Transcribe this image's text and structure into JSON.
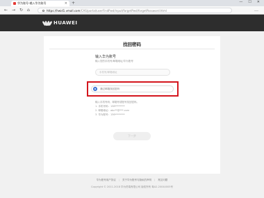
{
  "browser": {
    "tab_title": "华为账号-输入华为账号",
    "tab_close": "×",
    "new_tab": "+",
    "window_controls": [
      "—",
      "☐",
      "✕"
    ],
    "nav": {
      "back": "←",
      "forward": "→",
      "reload": "↻",
      "home": "⌂",
      "more": "…"
    },
    "url_domain": "https://hwid1.vmall.com",
    "url_path": "/CAS/portal/userFindPwd/input/forgetPwd/forgetPassword.html"
  },
  "header": {
    "logo_text": "HUAWEI"
  },
  "card": {
    "title": "找回密码",
    "section_heading": "输入华为账号",
    "section_sub": "输入您的手机号/邮箱地址/华为账号",
    "account_input": {
      "value": "",
      "placeholder": "手机号/邮箱地址"
    },
    "method_option_label": "通过邮箱找回密码",
    "options_intro": "输入手机号码、邮箱号或账号找回密码。",
    "options": [
      "1. 手机号码：138********",
      "2. 邮箱地址：abc**@***.com",
      "3. 华为账号：136********"
    ],
    "next_label": "下一步"
  },
  "footer": {
    "links": [
      "华为账号用户协议",
      "关于华为账号与隐私的声明",
      "常见问题"
    ],
    "copyright": "Copyright © 2011-2018 华为终端有限公司 版权所有 粤A2-20044005号"
  },
  "colors": {
    "header_bg": "#2d2d2d",
    "highlight_border": "#d4151d",
    "radio_accent": "#3a73d4",
    "page_bg": "#f1f1f1"
  },
  "icons": {
    "favicon": "huawei-favicon",
    "lock": "lock-icon",
    "logo": "huawei-petal-logo"
  }
}
